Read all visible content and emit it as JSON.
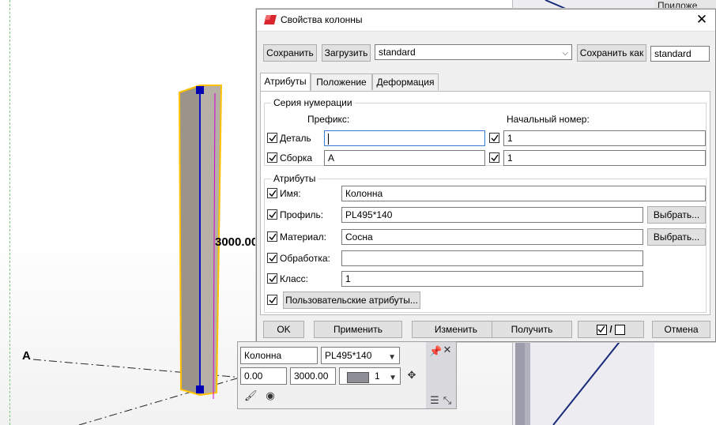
{
  "viewport": {
    "axis_label": "A",
    "dimension_label": "3000.00",
    "background_window_title": "Приложе"
  },
  "dialog": {
    "title": "Свойства колонны",
    "toolbar": {
      "save_label": "Сохранить",
      "load_label": "Загрузить",
      "preset_value": "standard",
      "save_as_label": "Сохранить как",
      "save_as_value": "standard"
    },
    "tabs": [
      {
        "label": "Атрибуты",
        "active": true
      },
      {
        "label": "Положение",
        "active": false
      },
      {
        "label": "Деформация",
        "active": false
      }
    ],
    "numbering": {
      "group_title": "Серия нумерации",
      "prefix_header": "Префикс:",
      "start_header": "Начальный номер:",
      "rows": [
        {
          "label": "Деталь",
          "prefix": "",
          "start": "1"
        },
        {
          "label": "Сборка",
          "prefix": "A",
          "start": "1"
        }
      ]
    },
    "attributes": {
      "group_title": "Атрибуты",
      "name_label": "Имя:",
      "name_value": "Колонна",
      "profile_label": "Профиль:",
      "profile_value": "PL495*140",
      "material_label": "Материал:",
      "material_value": "Сосна",
      "finish_label": "Обработка:",
      "finish_value": "",
      "class_label": "Класс:",
      "class_value": "1",
      "select_label": "Выбрать...",
      "user_attrs_label": "Пользовательские атрибуты..."
    },
    "footer": {
      "ok": "OK",
      "apply": "Применить",
      "modify": "Изменить",
      "get": "Получить",
      "toggle_separator": "/",
      "cancel": "Отмена"
    }
  },
  "mini_toolbar": {
    "name_value": "Колонна",
    "profile_value": "PL495*140",
    "offset_value": "0.00",
    "length_value": "3000.00",
    "class_value": "1"
  },
  "colors": {
    "column_outline": "#ffc000",
    "column_axis": "#1010c8",
    "handle": "#0000b0",
    "magenta_line": "#d000d0",
    "grid_green": "#7cc47c"
  }
}
